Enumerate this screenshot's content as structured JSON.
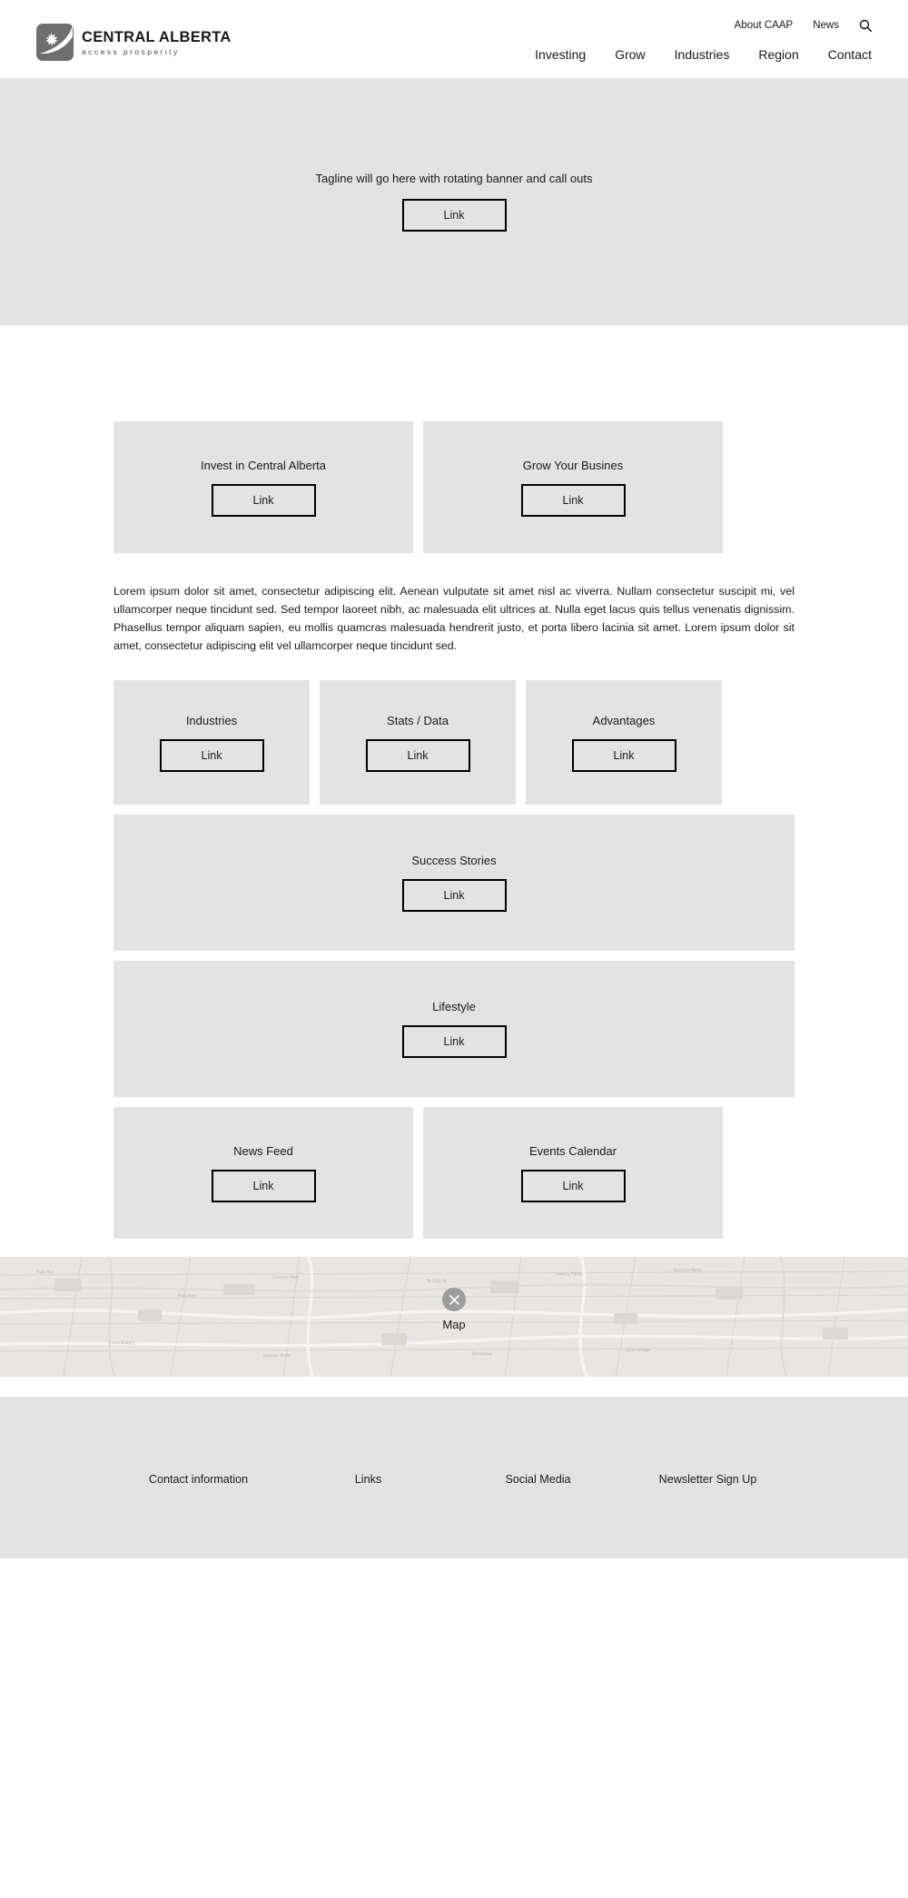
{
  "header": {
    "logo": {
      "icon": "maple-leaf-swoosh-logo",
      "title": "CENTRAL ALBERTA",
      "subtitle": "access prosperity"
    },
    "top_nav": [
      {
        "label": "About CAAP",
        "name": "top-nav-about-caap"
      },
      {
        "label": "News",
        "name": "top-nav-news"
      }
    ],
    "search_icon": "search-icon",
    "main_nav": [
      {
        "label": "Investing",
        "name": "main-nav-investing"
      },
      {
        "label": "Grow",
        "name": "main-nav-grow"
      },
      {
        "label": "Industries",
        "name": "main-nav-industries"
      },
      {
        "label": "Region",
        "name": "main-nav-region"
      },
      {
        "label": "Contact",
        "name": "main-nav-contact"
      }
    ]
  },
  "hero": {
    "tagline": "Tagline will go here with rotating banner and call outs",
    "link_label": "Link"
  },
  "promo_cards": [
    {
      "title": "Invest in Central Alberta",
      "link_label": "Link"
    },
    {
      "title": "Grow Your Busines",
      "link_label": "Link"
    }
  ],
  "intro": {
    "paragraph": "Lorem ipsum dolor sit amet, consectetur adipiscing elit. Aenean vulputate sit amet nisl ac viverra. Nullam consectetur suscipit mi, vel ullamcorper neque tincidunt sed. Sed tempor laoreet nibh, ac malesuada elit ultrices at. Nulla eget lacus quis tellus venenatis dignissim. Phasellus tempor aliquam sapien, eu mollis quamcras malesuada hendrerit justo, et porta libero lacinia sit amet. Lorem ipsum dolor sit amet, consectetur adipiscing elit vel ullamcorper neque tincidunt sed."
  },
  "feature_cards": [
    {
      "title": "Industries",
      "link_label": "Link"
    },
    {
      "title": "Stats / Data",
      "link_label": "Link"
    },
    {
      "title": "Advantages",
      "link_label": "Link"
    }
  ],
  "wide_cards": [
    {
      "title": "Success Stories",
      "link_label": "Link"
    },
    {
      "title": "Lifestyle",
      "link_label": "Link"
    }
  ],
  "bottom_cards": [
    {
      "title": "News Feed",
      "link_label": "Link"
    },
    {
      "title": "Events Calendar",
      "link_label": "Link"
    }
  ],
  "map": {
    "label": "Map",
    "pin_icon": "map-pin-marker-icon"
  },
  "footer": {
    "columns": [
      {
        "label": "Contact information",
        "name": "footer-contact-information"
      },
      {
        "label": "Links",
        "name": "footer-links"
      },
      {
        "label": "Social Media",
        "name": "footer-social-media"
      },
      {
        "label": "Newsletter Sign Up",
        "name": "footer-newsletter-sign-up"
      }
    ]
  },
  "colors": {
    "placeholder_block": "#e3e3e3",
    "page_background": "#ffffff",
    "border": "#000000",
    "logo_mark": "#6e6e6e"
  }
}
